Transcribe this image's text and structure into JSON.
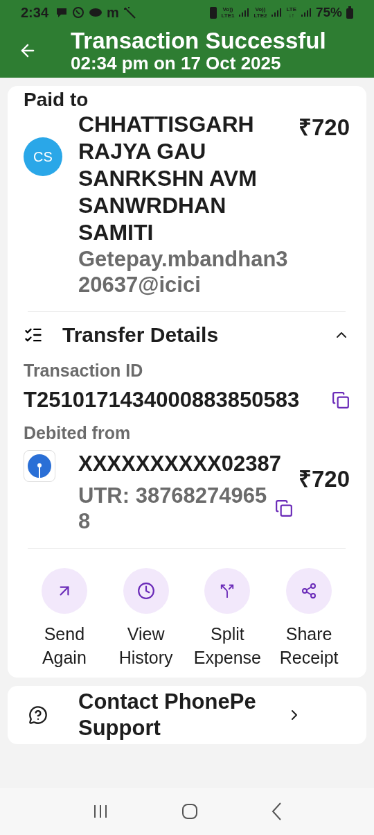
{
  "status_bar": {
    "time": "2:34",
    "app_letter": "m",
    "sims": [
      {
        "top": "Vo))",
        "bottom": "LTE1"
      },
      {
        "top": "Vo))",
        "bottom": "LTE2"
      },
      {
        "top": "LTE",
        "bottom": "↓↑"
      }
    ],
    "battery": "75%"
  },
  "header": {
    "title": "Transaction Successful",
    "subtitle": "02:34 pm on 17 Oct 2025"
  },
  "paid_to": {
    "label": "Paid to",
    "initials": "CS",
    "name": "CHHATTISGARH RAJYA GAU SANRKSHN AVM SANWRDHAN SAMITI",
    "upi_id": "Getepay.mbandhan320637@icici",
    "amount": "₹720"
  },
  "transfer_details": {
    "title": "Transfer Details",
    "expanded": true,
    "transaction_id_label": "Transaction ID",
    "transaction_id": "T2510171434000883850583",
    "debited_from_label": "Debited from",
    "account": "XXXXXXXXXX02387",
    "amount": "₹720",
    "utr": "UTR: 387682749658"
  },
  "actions": [
    {
      "kind": "send",
      "label": "Send Again"
    },
    {
      "kind": "history",
      "label": "View History"
    },
    {
      "kind": "split",
      "label": "Split Expense"
    },
    {
      "kind": "share",
      "label": "Share Receipt"
    }
  ],
  "support": {
    "label": "Contact PhonePe Support"
  }
}
